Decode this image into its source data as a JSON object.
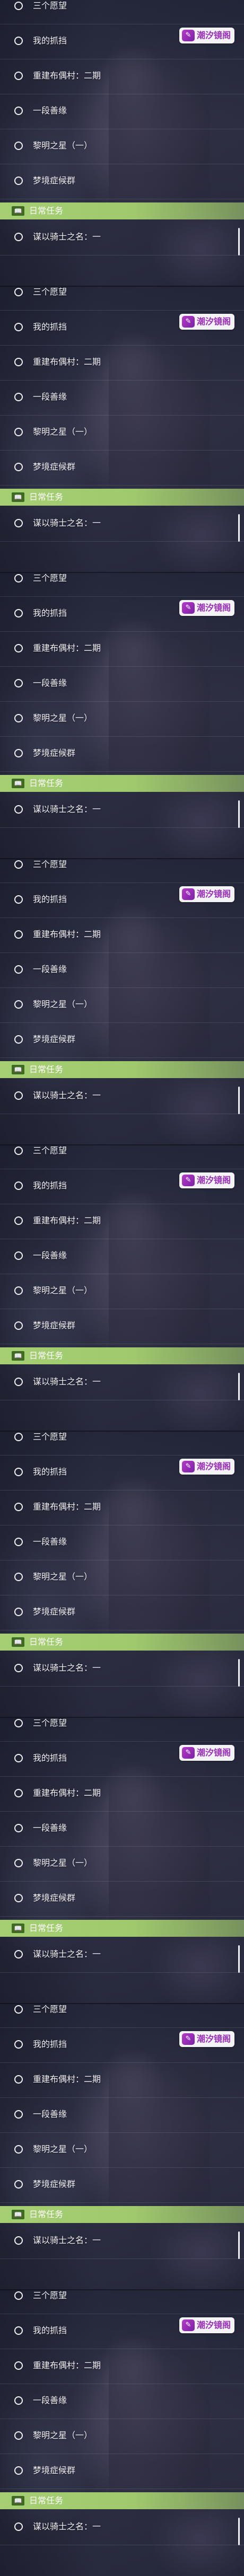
{
  "panel_count": 9,
  "quest_list": {
    "items": [
      {
        "label": "三个愿望"
      },
      {
        "label": "我的抓挡"
      },
      {
        "label": "重建布偶村：二期"
      },
      {
        "label": "一段善缘"
      },
      {
        "label": "黎明之星（一）"
      },
      {
        "label": "梦境症候群"
      }
    ],
    "section": {
      "icon_glyph": "📖",
      "title": "日常任务"
    },
    "after_section_item": {
      "label": "谋以骑士之名：一"
    }
  },
  "watermark": {
    "logo_glyph": "✎",
    "text": "潮汐镜阁"
  },
  "colors": {
    "section_bar": "#a5cf72",
    "watermark_text": "#9a2fb8"
  }
}
